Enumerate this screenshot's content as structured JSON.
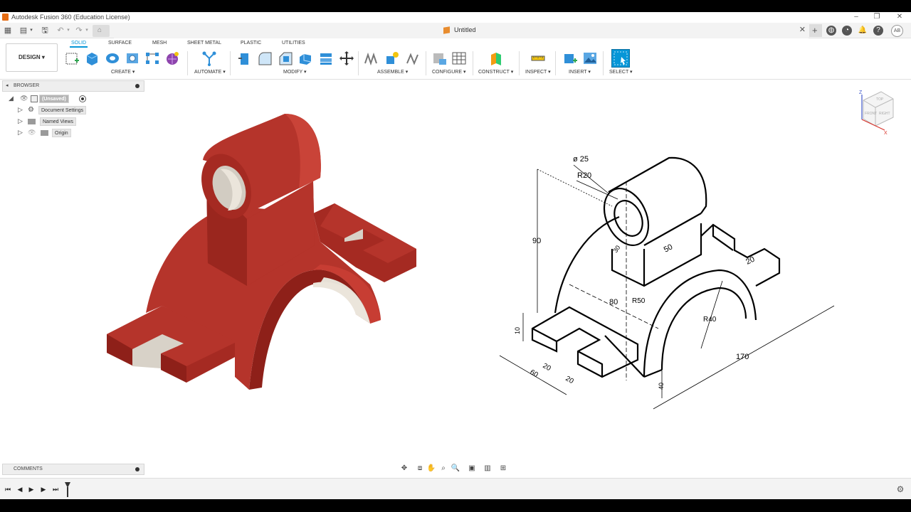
{
  "window": {
    "title": "Autodesk Fusion 360 (Education License)"
  },
  "document": {
    "title": "Untitled",
    "user_initials": "AB"
  },
  "workspace": {
    "label": "DESIGN"
  },
  "tabs": [
    {
      "label": "SOLID",
      "active": true
    },
    {
      "label": "SURFACE"
    },
    {
      "label": "MESH"
    },
    {
      "label": "SHEET METAL"
    },
    {
      "label": "PLASTIC"
    },
    {
      "label": "UTILITIES"
    }
  ],
  "groups": {
    "create": "CREATE",
    "automate": "AUTOMATE",
    "modify": "MODIFY",
    "assemble": "ASSEMBLE",
    "configure": "CONFIGURE",
    "construct": "CONSTRUCT",
    "inspect": "INSPECT",
    "insert": "INSERT",
    "select": "SELECT"
  },
  "browser": {
    "label": "BROWSER",
    "root": "(Unsaved)",
    "items": [
      "Document Settings",
      "Named Views",
      "Origin"
    ]
  },
  "comments": {
    "label": "COMMENTS"
  },
  "viewcube": {
    "faces": [
      "TOP",
      "FRONT",
      "RIGHT"
    ],
    "axes": [
      "Z",
      "X"
    ]
  },
  "drawing_dims": [
    "ø 25",
    "R20",
    "90",
    "30",
    "50",
    "80",
    "R50",
    "20",
    "R40",
    "170",
    "10",
    "60",
    "20",
    "20",
    "40"
  ],
  "colors": {
    "accent": "#0696d7",
    "model_red": "#b22f26"
  }
}
